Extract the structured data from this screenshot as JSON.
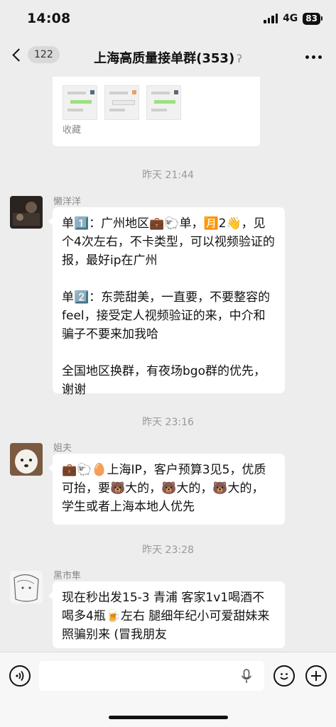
{
  "status_bar": {
    "time": "14:08",
    "network": "4G",
    "battery": "83"
  },
  "nav": {
    "unread_count": "122",
    "title": "上海高质量接单群(353)",
    "muted_icon": "ear-icon"
  },
  "favorite_card": {
    "footer": "收藏"
  },
  "messages": [
    {
      "timestamp": "昨天 21:44",
      "sender": "懒洋洋",
      "paragraphs": [
        "单1️⃣：广州地区💼🐑单，🈷️2👋，见个4次左右，不卡类型，可以视频验证的报，最好ip在广州",
        "单2️⃣：东莞甜美，一直要，不要整容的feel，接受定人视频验证的来，中介和骗子不要来加我哈",
        "全国地区换群，有夜场bgo群的优先，谢谢"
      ]
    },
    {
      "timestamp": "昨天 23:16",
      "sender": "姐夫",
      "paragraphs": [
        "💼🐑🥚上海IP，客户预算3见5，优质可抬，要🐻大的，🐻大的，🐻大的，学生或者上海本地人优先"
      ]
    },
    {
      "timestamp": "昨天 23:28",
      "sender": "黑市隼",
      "paragraphs": [
        "现在秒出发15-3 青浦 客家1v1喝酒不喝多4瓶🍺左右 腿细年纪小可爱甜妹来 照骗别来 (冒我朋友"
      ]
    }
  ],
  "input_bar": {
    "placeholder": ""
  }
}
